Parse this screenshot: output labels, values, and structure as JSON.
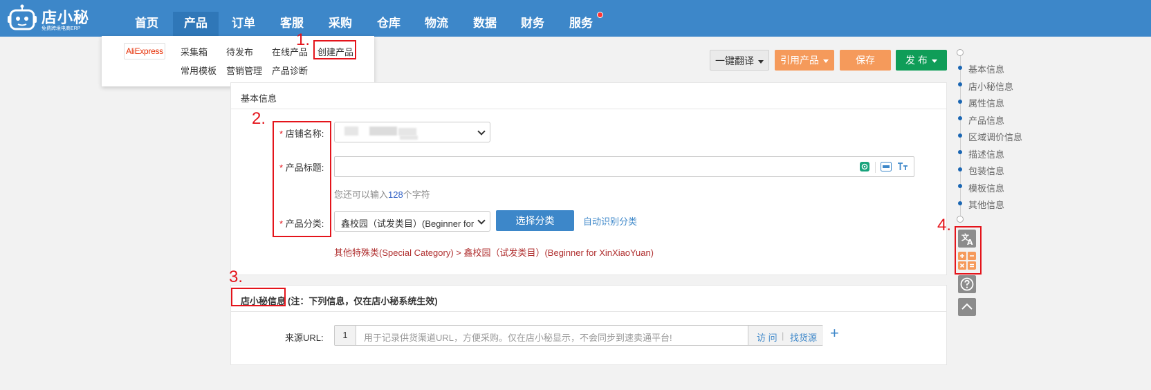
{
  "app": {
    "logo_title": "店小秘",
    "logo_subtitle": "免费跨境电商ERP"
  },
  "nav": {
    "items": [
      "首页",
      "产品",
      "订单",
      "客服",
      "采购",
      "仓库",
      "物流",
      "数据",
      "财务",
      "服务"
    ],
    "active": "产品",
    "colors": {
      "bar": "#3d87c9",
      "active": "#2f77b8",
      "notify_dot": "#ff3333"
    }
  },
  "dropdown": {
    "brand": "AliExpress",
    "row1": [
      "采集箱",
      "待发布",
      "在线产品",
      "创建产品"
    ],
    "row2": [
      "常用模板",
      "营销管理",
      "产品诊断"
    ]
  },
  "annotations": [
    "1.",
    "2.",
    "3.",
    "4."
  ],
  "toolbar": {
    "translate": "一键翻译",
    "cite": "引用产品",
    "save": "保存",
    "publish": "发 布",
    "colors": {
      "orange": "#f59a5b",
      "green": "#0f9d58"
    }
  },
  "basic_info": {
    "title": "基本信息",
    "required_mark": "*",
    "shop_label": "店铺名称:",
    "title_label": "产品标题:",
    "hint_prefix": "您还可以输入",
    "hint_count": "128",
    "hint_suffix": "个字符",
    "category_label": "产品分类:",
    "category_value": "鑫校园（试发类目）(Beginner for X",
    "select_category": "选择分类",
    "auto_category": "自动识别分类",
    "category_path": "其他特殊类(Special Category) > 鑫校园（试发类目）(Beginner for XinXiaoYuan)"
  },
  "dxm_info": {
    "title": "店小秘信息",
    "note": "(注：下列信息，仅在店小秘系统生效)",
    "source_label": "来源URL:",
    "row_index": "1",
    "source_placeholder": "用于记录供货渠道URL，方便采购。仅在店小秘显示，不会同步到速卖通平台!",
    "visit": "访 问",
    "divider": "|",
    "find_source": "找货源",
    "add": "+"
  },
  "side_nav": [
    "基本信息",
    "店小秘信息",
    "属性信息",
    "产品信息",
    "区域调价信息",
    "描述信息",
    "包装信息",
    "模板信息",
    "其他信息"
  ],
  "tools": [
    "translate-icon",
    "calculator-icon",
    "help-icon",
    "back-to-top-icon"
  ]
}
